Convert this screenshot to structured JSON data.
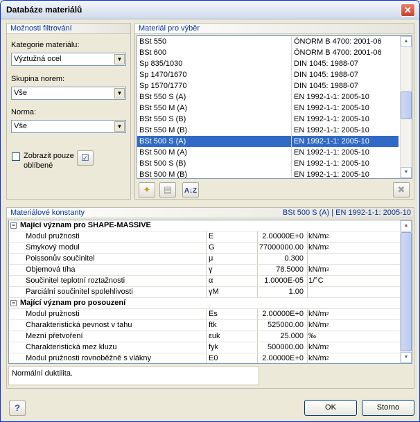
{
  "window": {
    "title": "Databáze materiálů",
    "close_label": "✕"
  },
  "filter": {
    "heading": "Možnosti filtrování",
    "category_label": "Kategorie materiálu:",
    "category_value": "Výztužná ocel",
    "group_label": "Skupina norem:",
    "group_value": "Vše",
    "norm_label": "Norma:",
    "norm_value": "Vše",
    "favorites_label_1": "Zobrazit pouze",
    "favorites_label_2": "oblíbené"
  },
  "selection": {
    "heading": "Materiál pro výběr",
    "rows": [
      {
        "name": "BSt 550",
        "norm": "ÖNORM B 4700: 2001-06"
      },
      {
        "name": "BSt 600",
        "norm": "ÖNORM B 4700: 2001-06"
      },
      {
        "name": "Sp 835/1030",
        "norm": "DIN 1045: 1988-07"
      },
      {
        "name": "Sp 1470/1670",
        "norm": "DIN 1045: 1988-07"
      },
      {
        "name": "Sp 1570/1770",
        "norm": "DIN 1045: 1988-07"
      },
      {
        "name": "BSt 550 S (A)",
        "norm": "EN 1992-1-1: 2005-10"
      },
      {
        "name": "BSt 550 M (A)",
        "norm": "EN 1992-1-1: 2005-10"
      },
      {
        "name": "BSt 550 S (B)",
        "norm": "EN 1992-1-1: 2005-10"
      },
      {
        "name": "BSt 550 M (B)",
        "norm": "EN 1992-1-1: 2005-10"
      },
      {
        "name": "BSt 500 S (A)",
        "norm": "EN 1992-1-1: 2005-10"
      },
      {
        "name": "BSt 500 M (A)",
        "norm": "EN 1992-1-1: 2005-10"
      },
      {
        "name": "BSt 500 S (B)",
        "norm": "EN 1992-1-1: 2005-10"
      },
      {
        "name": "BSt 500 M (B)",
        "norm": "EN 1992-1-1: 2005-10"
      }
    ],
    "selected_index": 9
  },
  "constants": {
    "heading": "Materiálové konstanty",
    "header_right": "BSt 500 S (A)  |  EN 1992-1-1: 2005-10",
    "sections": [
      {
        "title": "Mající význam pro SHAPE-MASSIVE",
        "rows": [
          {
            "name": "Modul pružnosti",
            "symbol": "E",
            "value": "2.00000E+0",
            "unit": "kN/m",
            "unit_sup": "2"
          },
          {
            "name": "Smykový modul",
            "symbol": "G",
            "value": "77000000.00",
            "unit": "kN/m",
            "unit_sup": "2"
          },
          {
            "name": "Poissonův součinitel",
            "symbol": "μ",
            "value": "0.300",
            "unit": "",
            "unit_sup": ""
          },
          {
            "name": "Objemová tíha",
            "symbol": "γ",
            "value": "78.5000",
            "unit": "kN/m",
            "unit_sup": "3"
          },
          {
            "name": "Součinitel teplotní roztažnosti",
            "symbol": "α",
            "value": "1.0000E-05",
            "unit": "1/°C",
            "unit_sup": ""
          },
          {
            "name": "Parciální součinitel spolehlivosti",
            "symbol": "γM",
            "value": "1.00",
            "unit": "",
            "unit_sup": ""
          }
        ]
      },
      {
        "title": "Mající význam pro posouzení",
        "rows": [
          {
            "name": "Modul pružnosti",
            "symbol": "Es",
            "value": "2.00000E+0",
            "unit": "kN/m",
            "unit_sup": "2"
          },
          {
            "name": "Charakteristická pevnost v tahu",
            "symbol": "ftk",
            "value": "525000.00",
            "unit": "kN/m",
            "unit_sup": "2"
          },
          {
            "name": "Mezní přetvoření",
            "symbol": "εuk",
            "value": "25.000",
            "unit": "‰",
            "unit_sup": ""
          },
          {
            "name": "Charakteristická mez kluzu",
            "symbol": "fyk",
            "value": "500000.00",
            "unit": "kN/m",
            "unit_sup": "2"
          },
          {
            "name": "Modul pružnosti rovnoběžně s vlákny",
            "symbol": "E0",
            "value": "2.00000E+0",
            "unit": "kN/m",
            "unit_sup": "2"
          }
        ]
      }
    ],
    "note": "Normální duktilita."
  },
  "footer": {
    "ok_label": "OK",
    "cancel_label": "Storno"
  },
  "colors": {
    "selection": "#316ac5",
    "title_bar": "#dfe6f1",
    "group_heading_text": "#003399"
  }
}
